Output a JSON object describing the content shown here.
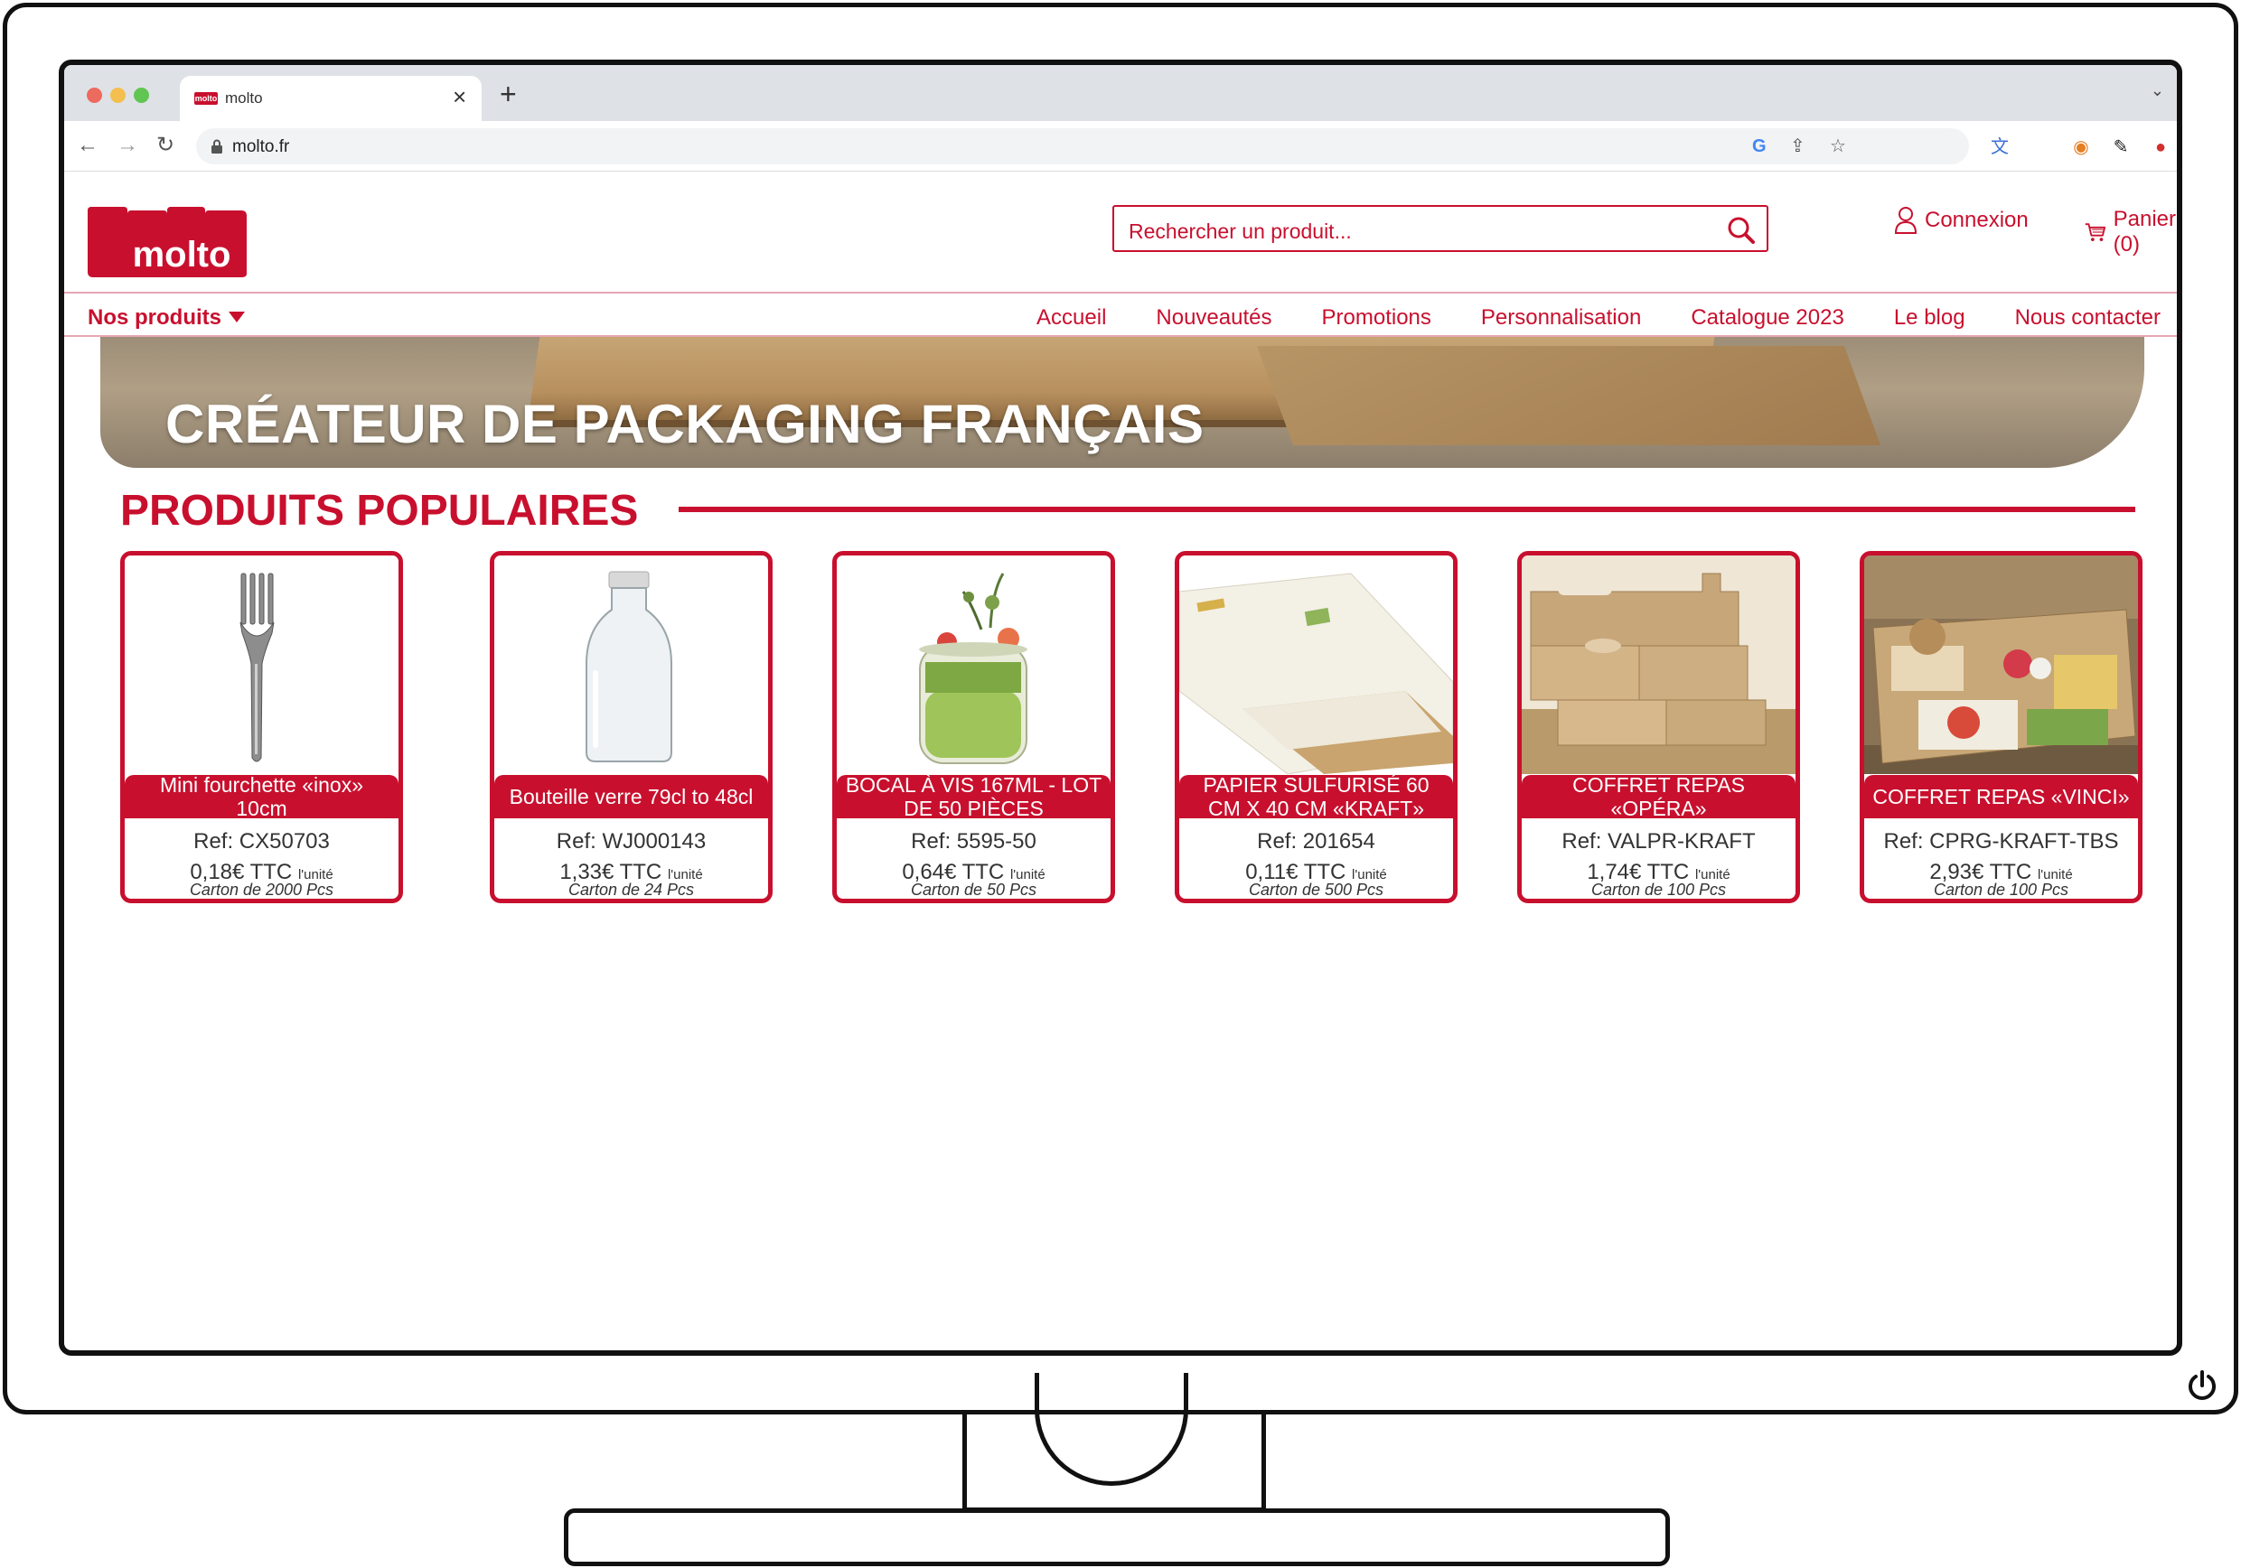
{
  "browser": {
    "tab_title": "molto",
    "tab_favicon": "molto",
    "url": "molto.fr"
  },
  "header": {
    "logo_text": "molto",
    "search_placeholder": "Rechercher un produit...",
    "login_label": "Connexion",
    "cart_label": "Panier (0)"
  },
  "nav": {
    "products_label": "Nos produits",
    "links": [
      "Accueil",
      "Nouveautés",
      "Promotions",
      "Personnalisation",
      "Catalogue 2023",
      "Le blog",
      "Nous contacter"
    ]
  },
  "banner": {
    "title": "CRÉATEUR DE PACKAGING FRANÇAIS"
  },
  "section": {
    "title": "PRODUITS POPULAIRES"
  },
  "products": [
    {
      "name": "Mini fourchette «inox» 10cm",
      "ref": "Ref: CX50703",
      "price": "0,18€ TTC",
      "unit": "l'unité",
      "carton": "Carton de 2000 Pcs",
      "image": "fork"
    },
    {
      "name": "Bouteille verre 79cl to 48cl",
      "ref": "Ref: WJ000143",
      "price": "1,33€ TTC",
      "unit": "l'unité",
      "carton": "Carton de 24 Pcs",
      "image": "bottle"
    },
    {
      "name": "BOCAL À VIS 167ML - LOT DE 50 PIÈCES",
      "ref": "Ref: 5595-50",
      "price": "0,64€ TTC",
      "unit": "l'unité",
      "carton": "Carton de 50 Pcs",
      "image": "jar"
    },
    {
      "name": "PAPIER SULFURISÉ 60 CM X 40 CM «KRAFT»",
      "ref": "Ref: 201654",
      "price": "0,11€ TTC",
      "unit": "l'unité",
      "carton": "Carton de 500 Pcs",
      "image": "paper"
    },
    {
      "name": "COFFRET REPAS «OPÉRA»",
      "ref": "Ref: VALPR-KRAFT",
      "price": "1,74€ TTC",
      "unit": "l'unité",
      "carton": "Carton de 100 Pcs",
      "image": "kraft-boxes"
    },
    {
      "name": "COFFRET REPAS «VINCI»",
      "ref": "Ref: CPRG-KRAFT-TBS",
      "price": "2,93€ TTC",
      "unit": "l'unité",
      "carton": "Carton de 100 Pcs",
      "image": "meal-tray"
    }
  ],
  "colors": {
    "brand": "#c8102e",
    "chrome_bg": "#dee1e6"
  },
  "icons": [
    "back-icon",
    "forward-icon",
    "reload-icon",
    "lock-icon",
    "google-icon",
    "share-icon",
    "star-icon",
    "extensions-icon",
    "sidepanel-icon",
    "profile-icon",
    "menu-icon",
    "search-icon",
    "user-icon",
    "cart-icon",
    "power-icon"
  ]
}
